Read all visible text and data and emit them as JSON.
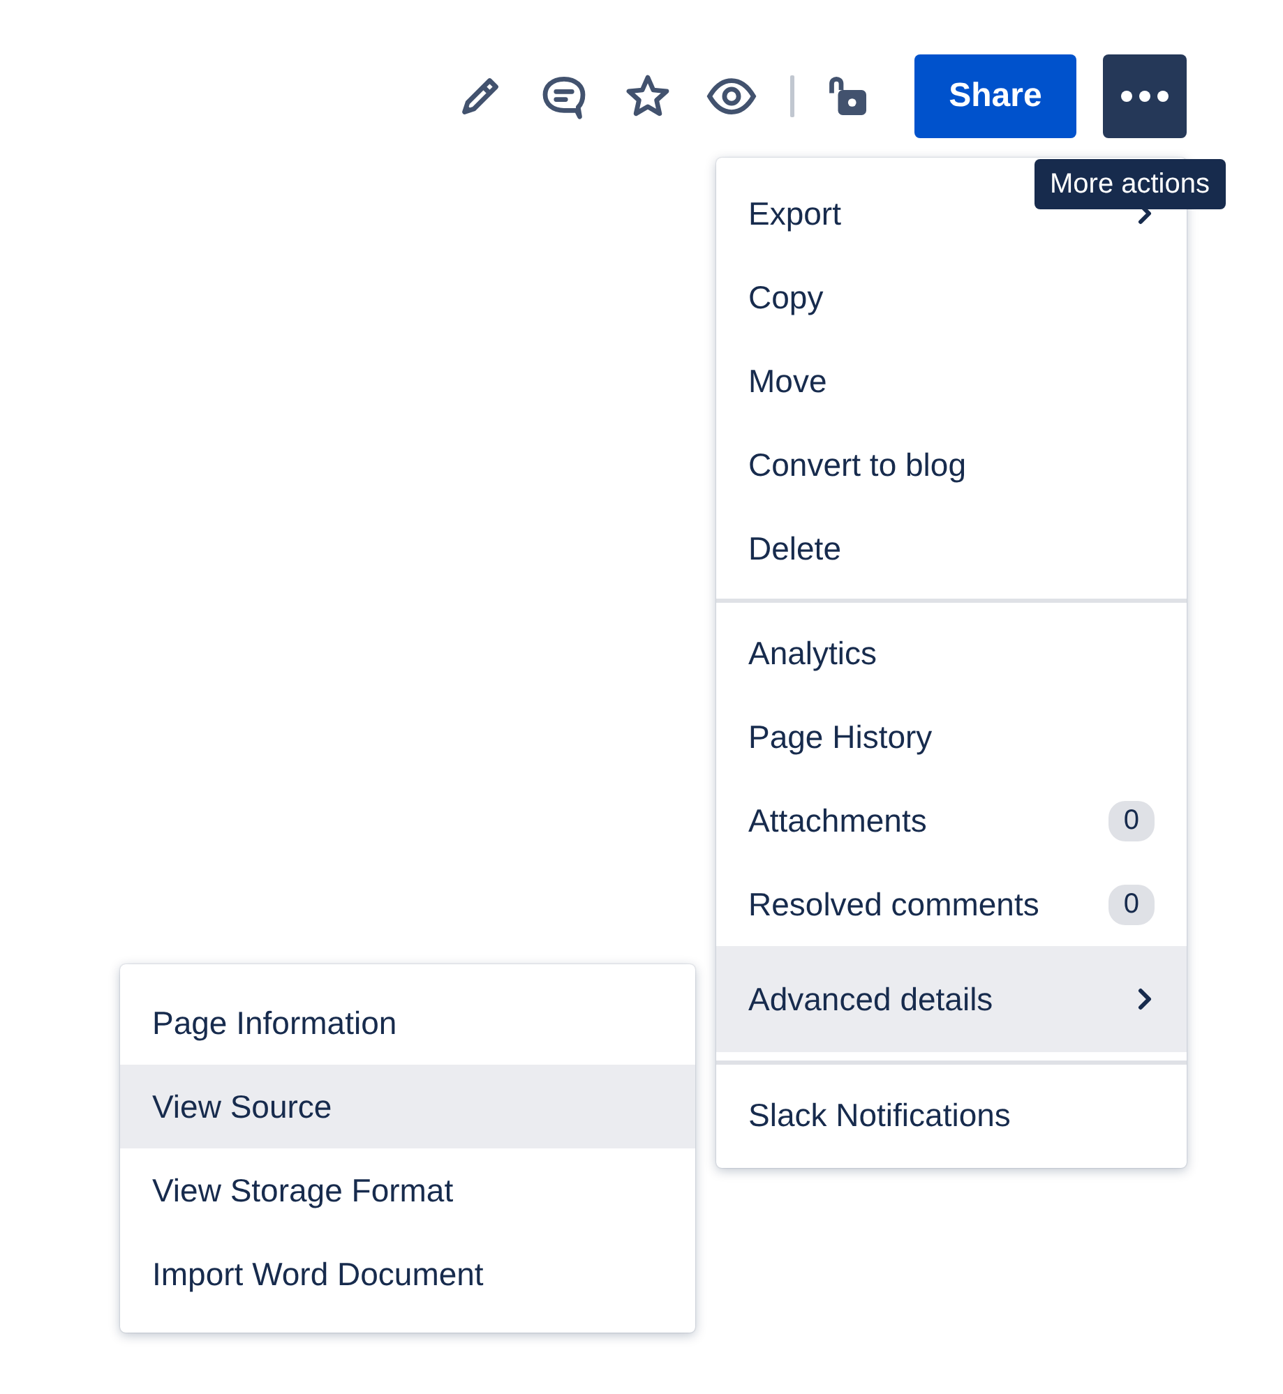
{
  "toolbar": {
    "icons": [
      {
        "kind": "edit"
      },
      {
        "kind": "comment"
      },
      {
        "kind": "star"
      },
      {
        "kind": "watch"
      },
      {
        "kind": "divider"
      },
      {
        "kind": "restrictions"
      }
    ],
    "share_button": {
      "label": "Share"
    },
    "more_button": {
      "selected": true
    },
    "tooltip": {
      "text": "More actions"
    }
  },
  "menu": {
    "sections": [
      {
        "items": [
          {
            "label": "Export",
            "submenu": true,
            "selected": false
          },
          {
            "label": "Copy",
            "submenu": false,
            "selected": false
          },
          {
            "label": "Move",
            "submenu": false,
            "selected": false
          },
          {
            "label": "Convert to blog",
            "submenu": false,
            "selected": false
          },
          {
            "label": "Delete",
            "submenu": false,
            "selected": false
          }
        ]
      },
      {
        "items": [
          {
            "label": "Analytics",
            "submenu": false,
            "selected": false
          },
          {
            "label": "Page History",
            "submenu": false,
            "selected": false
          },
          {
            "label": "Attachments",
            "submenu": false,
            "selected": false,
            "badge": "0"
          },
          {
            "label": "Resolved comments",
            "submenu": false,
            "selected": false,
            "badge": "0"
          },
          {
            "label": "Advanced details",
            "submenu": true,
            "selected": true
          }
        ]
      },
      {
        "items": [
          {
            "label": "Slack Notifications",
            "submenu": false,
            "selected": false
          }
        ]
      }
    ]
  },
  "submenu": {
    "items": [
      {
        "label": "Page Information",
        "selected": false
      },
      {
        "label": "View Source",
        "selected": true
      },
      {
        "label": "View Storage Format",
        "selected": false
      },
      {
        "label": "Import Word Document",
        "selected": false
      }
    ]
  }
}
